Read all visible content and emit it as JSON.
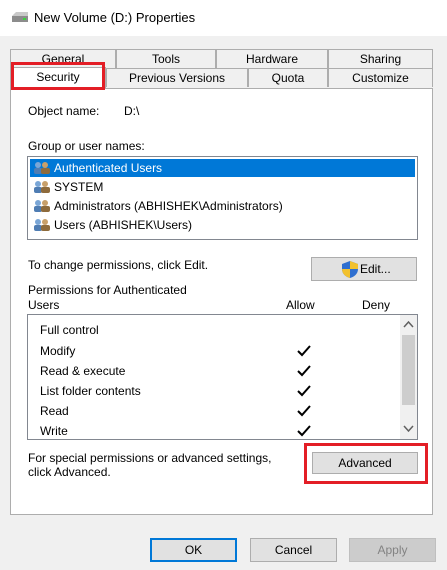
{
  "window": {
    "title": "New Volume (D:) Properties"
  },
  "tabs": {
    "row1": [
      "General",
      "Tools",
      "Hardware",
      "Sharing"
    ],
    "row2": [
      "Security",
      "Previous Versions",
      "Quota",
      "Customize"
    ],
    "active": "Security"
  },
  "object": {
    "label": "Object name:",
    "value": "D:\\"
  },
  "groups": {
    "label": "Group or user names:",
    "items": [
      "Authenticated Users",
      "SYSTEM",
      "Administrators (ABHISHEK\\Administrators)",
      "Users (ABHISHEK\\Users)"
    ],
    "selected_index": 0
  },
  "edit": {
    "hint": "To change permissions, click Edit.",
    "button_label": "Edit..."
  },
  "permissions": {
    "header_line1": "Permissions for Authenticated",
    "header_line2": "Users",
    "allow_label": "Allow",
    "deny_label": "Deny",
    "rows": [
      {
        "name": "Full control",
        "allow": false,
        "deny": false
      },
      {
        "name": "Modify",
        "allow": true,
        "deny": false
      },
      {
        "name": "Read & execute",
        "allow": true,
        "deny": false
      },
      {
        "name": "List folder contents",
        "allow": true,
        "deny": false
      },
      {
        "name": "Read",
        "allow": true,
        "deny": false
      },
      {
        "name": "Write",
        "allow": true,
        "deny": false
      }
    ]
  },
  "advanced": {
    "hint_line1": "For special permissions or advanced settings,",
    "hint_line2": "click Advanced.",
    "button_label": "Advanced"
  },
  "footer": {
    "ok": "OK",
    "cancel": "Cancel",
    "apply": "Apply"
  },
  "colors": {
    "highlight": "#e31e26",
    "selection": "#0078d7"
  }
}
